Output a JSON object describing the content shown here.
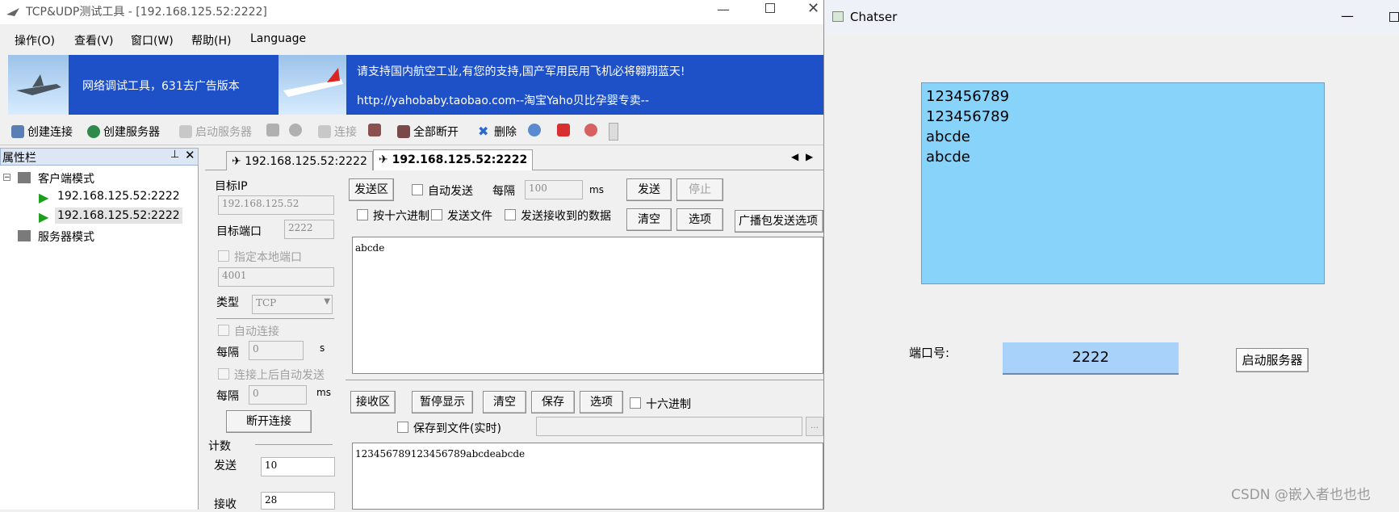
{
  "left_window": {
    "title": "TCP&UDP测试工具 - [192.168.125.52:2222]",
    "menu": [
      "操作(O)",
      "查看(V)",
      "窗口(W)",
      "帮助(H)",
      "Language"
    ],
    "banner": {
      "left_text": "网络调试工具，631去广告版本",
      "line1": "请支持国内航空工业,有您的支持,国产军用民用飞机必将翱翔蓝天!",
      "line2": "http://yahobaby.taobao.com--淘宝Yaho贝比孕婴专卖--"
    },
    "toolbar": {
      "create_conn": "创建连接",
      "create_server": "创建服务器",
      "start_server": "启动服务器",
      "connect": "连接",
      "disconnect_all": "全部断开",
      "delete": "删除"
    },
    "props": {
      "title": "属性栏",
      "client_mode": "客户端模式",
      "client1": "192.168.125.52:2222",
      "client2": "192.168.125.52:2222",
      "server_mode": "服务器模式"
    },
    "tabs": [
      "192.168.125.52:2222",
      "192.168.125.52:2222"
    ],
    "settings": {
      "target_ip_label": "目标IP",
      "target_ip": "192.168.125.52",
      "target_port_label": "目标端口",
      "target_port": "2222",
      "local_port_label": "指定本地端口",
      "local_port": "4001",
      "type_label": "类型",
      "type_value": "TCP",
      "auto_connect_label": "自动连接",
      "interval_label": "每隔",
      "interval1": "0",
      "interval1_unit": "s",
      "auto_send_after_label": "连接上后自动发送",
      "interval2": "0",
      "interval2_unit": "ms",
      "disconnect_btn": "断开连接",
      "count_label": "计数",
      "send_label": "发送",
      "send_count": "10",
      "recv_label": "接收",
      "recv_count": "28"
    },
    "send_area": {
      "title": "发送区",
      "auto_send": "自动发送",
      "interval_label": "每隔",
      "interval": "100",
      "unit": "ms",
      "send_btn": "发送",
      "stop_btn": "停止",
      "hex_send": "按十六进制",
      "send_file": "发送文件",
      "send_received": "发送接收到的数据",
      "clear_btn": "清空",
      "options_btn": "选项",
      "broadcast_btn": "广播包发送选项",
      "content": "abcde"
    },
    "recv_area": {
      "title": "接收区",
      "pause_btn": "暂停显示",
      "clear_btn": "清空",
      "save_btn": "保存",
      "options_btn": "选项",
      "hex_label": "十六进制",
      "save_to_file": "保存到文件(实时)",
      "content": "123456789123456789abcdeabcde"
    }
  },
  "right_window": {
    "title": "Chatser",
    "messages": [
      "123456789",
      "123456789",
      "abcde",
      "abcde"
    ],
    "port_label": "端口号:",
    "port_value": "2222",
    "start_btn": "启动服务器"
  },
  "watermark": "CSDN @嵌入者也也也"
}
